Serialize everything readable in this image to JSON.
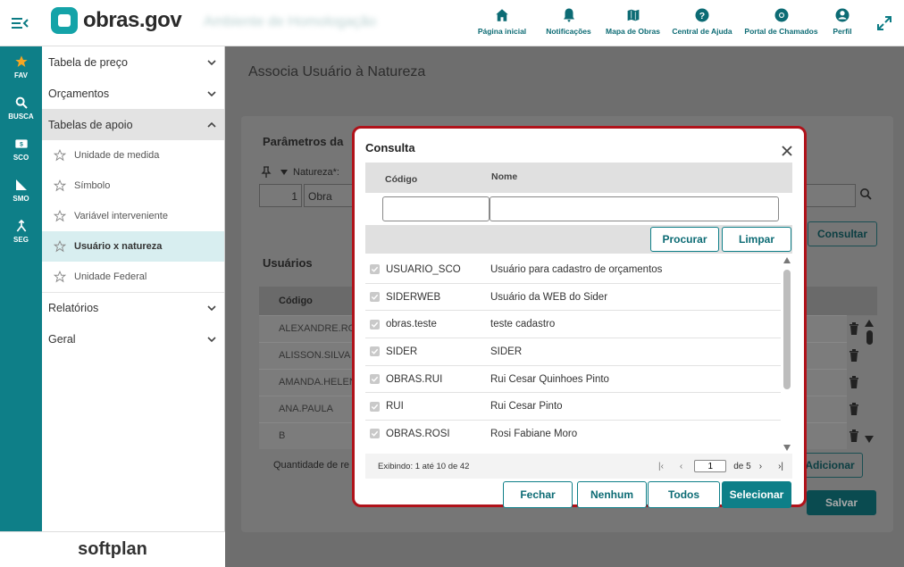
{
  "header": {
    "logo_text": "obras.gov",
    "blurred_text": "Ambiente de Homologação",
    "nav": [
      {
        "label": "Página inicial",
        "icon": "home-icon"
      },
      {
        "label": "Notificações",
        "icon": "bell-icon"
      },
      {
        "label": "Mapa de Obras",
        "icon": "map-icon"
      },
      {
        "label": "Central de Ajuda",
        "icon": "help-icon"
      },
      {
        "label": "Portal de Chamados",
        "icon": "lifebuoy-icon"
      },
      {
        "label": "Perfil",
        "icon": "user-icon"
      }
    ]
  },
  "leftbar": [
    {
      "label": "FAV",
      "icon": "star-icon"
    },
    {
      "label": "BUSCA",
      "icon": "search-icon"
    },
    {
      "label": "SCO",
      "icon": "sco-icon"
    },
    {
      "label": "SMO",
      "icon": "smo-icon"
    },
    {
      "label": "SEG",
      "icon": "seg-icon"
    }
  ],
  "sidebar": {
    "sections": [
      {
        "label": "Tabela de preço"
      },
      {
        "label": "Orçamentos"
      },
      {
        "label": "Tabelas de apoio"
      },
      {
        "label": "Relatórios"
      },
      {
        "label": "Geral"
      }
    ],
    "sub_items": [
      {
        "label": "Unidade de medida"
      },
      {
        "label": "Símbolo"
      },
      {
        "label": "Variável interveniente"
      },
      {
        "label": "Usuário x natureza"
      },
      {
        "label": "Unidade Federal"
      }
    ],
    "footer_brand": "softplan"
  },
  "page": {
    "title": "Associa Usuário à Natureza",
    "params_title": "Parâmetros da",
    "natureza_label": "Natureza*:",
    "natureza_code": "1",
    "natureza_name": "Obra",
    "consultar": "Consultar",
    "users_title": "Usuários",
    "col_codigo": "Código",
    "users": [
      "ALEXANDRE.RO",
      "ALISSON.SILVA",
      "AMANDA.HELEN",
      "ANA.PAULA",
      "B"
    ],
    "quantidade": "Quantidade de re",
    "adicionar": "Adicionar",
    "salvar": "Salvar"
  },
  "modal": {
    "title": "Consulta",
    "col_codigo": "Código",
    "col_nome": "Nome",
    "filter_codigo": "",
    "filter_nome": "",
    "procurar": "Procurar",
    "limpar": "Limpar",
    "rows": [
      {
        "codigo": "USUARIO_SCO",
        "nome": "Usuário para cadastro de orçamentos"
      },
      {
        "codigo": "SIDERWEB",
        "nome": "Usuário da WEB do Sider"
      },
      {
        "codigo": "obras.teste",
        "nome": "teste cadastro"
      },
      {
        "codigo": "SIDER",
        "nome": "SIDER"
      },
      {
        "codigo": "OBRAS.RUI",
        "nome": "Rui Cesar Quinhoes Pinto"
      },
      {
        "codigo": "RUI",
        "nome": "Rui Cesar Pinto"
      },
      {
        "codigo": "OBRAS.ROSI",
        "nome": "Rosi Fabiane Moro"
      }
    ],
    "exibindo": "Exibindo: 1 até 10 de 42",
    "page_current": "1",
    "page_total_label": "de 5",
    "fechar": "Fechar",
    "nenhum": "Nenhum",
    "todos": "Todos",
    "selecionar": "Selecionar"
  }
}
